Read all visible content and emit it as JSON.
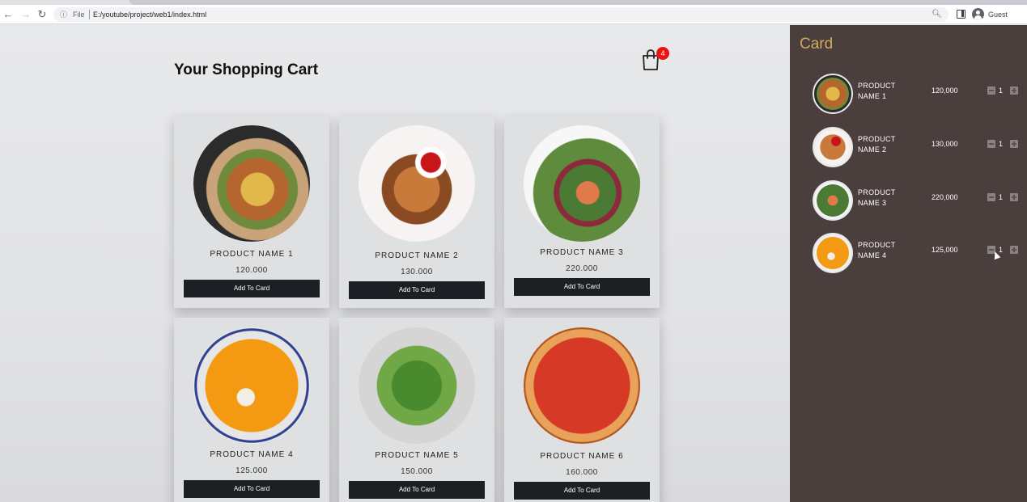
{
  "browser": {
    "info_label": "ⓘ",
    "file_label": "File",
    "url": "E:/youtube/project/web1/index.html",
    "profile_label": "Guest"
  },
  "main": {
    "title": "Your Shopping Cart",
    "cart_count": "4",
    "products": [
      {
        "name": "PRODUCT NAME 1",
        "price": "120.000",
        "button": "Add To Card"
      },
      {
        "name": "PRODUCT NAME 2",
        "price": "130.000",
        "button": "Add To Card"
      },
      {
        "name": "PRODUCT NAME 3",
        "price": "220.000",
        "button": "Add To Card"
      },
      {
        "name": "PRODUCT NAME 4",
        "price": "125.000",
        "button": "Add To Card"
      },
      {
        "name": "PRODUCT NAME 5",
        "price": "150.000",
        "button": "Add To Card"
      },
      {
        "name": "PRODUCT NAME 6",
        "price": "160.000",
        "button": "Add To Card"
      }
    ]
  },
  "sidebar": {
    "title": "Card",
    "items": [
      {
        "name_line1": "PRODUCT",
        "name_line2": "NAME 1",
        "price": "120,000",
        "qty": "1"
      },
      {
        "name_line1": "PRODUCT",
        "name_line2": "NAME 2",
        "price": "130,000",
        "qty": "1"
      },
      {
        "name_line1": "PRODUCT",
        "name_line2": "NAME 3",
        "price": "220,000",
        "qty": "1"
      },
      {
        "name_line1": "PRODUCT",
        "name_line2": "NAME 4",
        "price": "125,000",
        "qty": "1"
      }
    ]
  },
  "colors": {
    "sidebar_bg": "#4a3f3d",
    "sidebar_title": "#d4a95b",
    "button_bg": "#1c1f24",
    "badge": "#ee1111"
  }
}
